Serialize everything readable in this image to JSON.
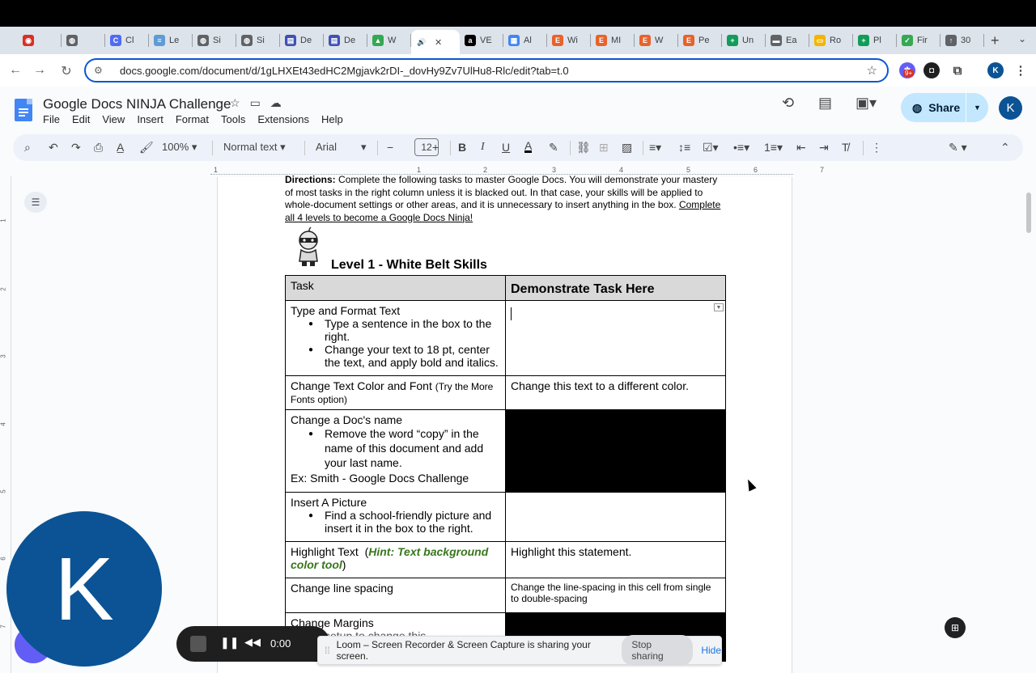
{
  "tabs": [
    {
      "label": "",
      "fav_color": "#d93025",
      "fav": "◉"
    },
    {
      "label": "",
      "fav_color": "#5f6368",
      "fav": "◍"
    },
    {
      "label": "Cl",
      "fav_color": "#4e6bf5",
      "fav": "C"
    },
    {
      "label": "Le",
      "fav_color": "#5f9bd5",
      "fav": "≡"
    },
    {
      "label": "Si",
      "fav_color": "#5f6368",
      "fav": "◍"
    },
    {
      "label": "Si",
      "fav_color": "#5f6368",
      "fav": "◍"
    },
    {
      "label": "De",
      "fav_color": "#3f51b5",
      "fav": "▤"
    },
    {
      "label": "De",
      "fav_color": "#3f51b5",
      "fav": "▤"
    },
    {
      "label": "W",
      "fav_color": "#34a853",
      "fav": "▲"
    },
    {
      "label": "",
      "fav_color": "#ffffff",
      "fav": "🔊",
      "active": true
    },
    {
      "label": "VE",
      "fav_color": "#000000",
      "fav": "a"
    },
    {
      "label": "Al",
      "fav_color": "#4285f4",
      "fav": "▦"
    },
    {
      "label": "Wi",
      "fav_color": "#e8622c",
      "fav": "E"
    },
    {
      "label": "MI",
      "fav_color": "#e8622c",
      "fav": "E"
    },
    {
      "label": "W",
      "fav_color": "#e8622c",
      "fav": "E"
    },
    {
      "label": "Pe",
      "fav_color": "#e8622c",
      "fav": "E"
    },
    {
      "label": "Un",
      "fav_color": "#0f9d58",
      "fav": "+"
    },
    {
      "label": "Ea",
      "fav_color": "#5f6368",
      "fav": "▬"
    },
    {
      "label": "Ro",
      "fav_color": "#f4b400",
      "fav": "▭"
    },
    {
      "label": "Pl",
      "fav_color": "#0f9d58",
      "fav": "+"
    },
    {
      "label": "Fir",
      "fav_color": "#34a853",
      "fav": "✓"
    },
    {
      "label": "30",
      "fav_color": "#5f6368",
      "fav": "↑"
    }
  ],
  "address": {
    "url": "docs.google.com/document/d/1gLHXEt43edHC2Mgjavk2rDI-_dovHy9Zv7UlHu8-Rlc/edit?tab=t.0",
    "badge": "9+"
  },
  "doc": {
    "title": "Google Docs NINJA Challenge",
    "menus": [
      "File",
      "Edit",
      "View",
      "Insert",
      "Format",
      "Tools",
      "Extensions",
      "Help"
    ],
    "share_label": "Share",
    "avatar_letter": "K"
  },
  "toolbar": {
    "zoom": "100%",
    "style": "Normal text",
    "font": "Arial",
    "font_size": "12"
  },
  "ruler": {
    "h_numbers": [
      "1",
      "1",
      "2",
      "3",
      "4",
      "5",
      "6",
      "7"
    ],
    "v_numbers": [
      "1",
      "2",
      "3",
      "4",
      "5",
      "6",
      "7"
    ]
  },
  "content": {
    "directions_bold": "Directions:",
    "directions_text": " Complete the following tasks to master Google Docs. You will demonstrate your mastery of most tasks in the right column unless it is blacked out. In that case, your skills will be applied to whole-document settings or other areas, and it is unnecessary to insert anything in the box. ",
    "directions_link": "Complete all 4 levels to become a Google Docs Ninja!",
    "level_heading": "Level 1 - White Belt Skills",
    "header_task": "Task",
    "header_demo": "Demonstrate Task Here",
    "rows": {
      "r1_title": "Type and Format Text",
      "r1_b1": "Type a sentence in the box to the right.",
      "r1_b2": "Change your text to 18 pt, center the text, and apply bold and italics.",
      "r2_title": "Change Text Color and Font",
      "r2_note": "(Try the More Fonts option)",
      "r2_demo": "Change this text to a different color.",
      "r3_title": "Change a Doc's name",
      "r3_b1": "Remove the word “copy” in the name of this document and add your last name.",
      "r3_ex": "Ex: Smith - Google Docs Challenge",
      "r4_title": "Insert A Picture",
      "r4_b1": "Find a school-friendly picture and insert it in the  box to the right.",
      "r5_title": "Highlight Text",
      "r5_hint": "Hint: Text background color tool",
      "r5_demo": "Highlight this statement.",
      "r6_title": "Change line spacing",
      "r6_demo": "Change the line-spacing in this cell from single to double-spacing",
      "r7_title": "Change Margins",
      "r7_sub": "setup to change this"
    }
  },
  "overlays": {
    "webcam_letter": "K",
    "loom_time": "0:00",
    "loom_message": "Loom – Screen Recorder & Screen Capture is sharing your screen.",
    "stop_sharing": "Stop sharing",
    "hide": "Hide"
  }
}
